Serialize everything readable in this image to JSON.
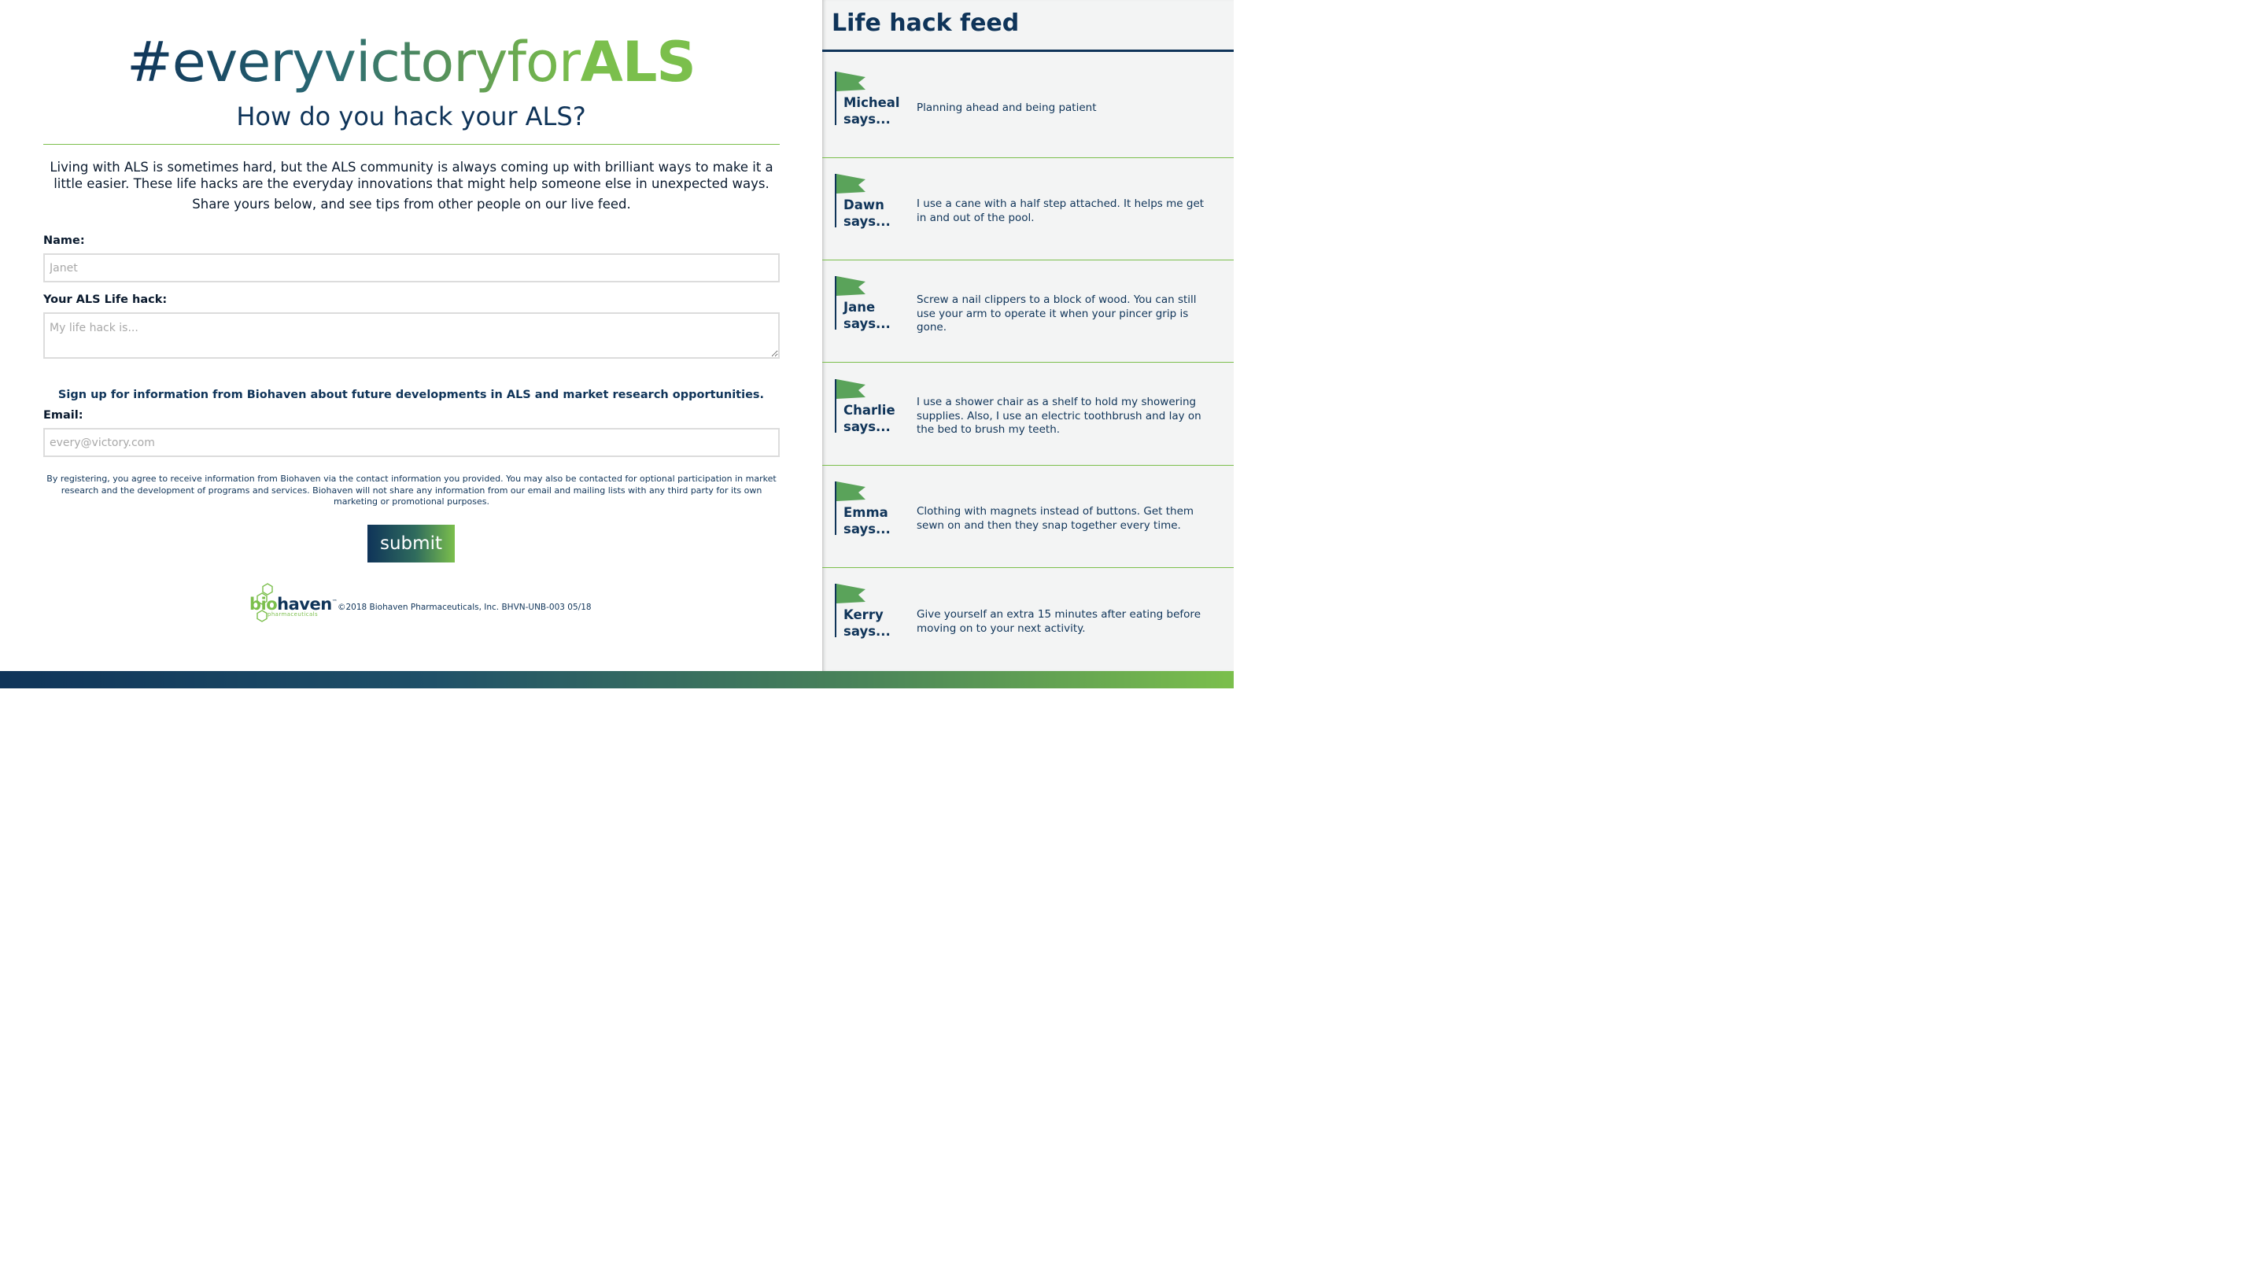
{
  "hero": {
    "title_hash_part": "#everyvictoryfor",
    "title_strong_part": "ALS",
    "subtitle": "How do you hack your ALS?"
  },
  "intro": {
    "paragraph": "Living with ALS is sometimes hard, but the ALS community is always coming up with brilliant ways to make it a little easier. These life hacks are the everyday innovations that might help someone else in unexpected ways.",
    "share_line": "Share yours below, and see tips from other people on our live feed."
  },
  "form": {
    "name_label": "Name:",
    "name_placeholder": "Janet",
    "hack_label": "Your ALS Life hack:",
    "hack_placeholder": "My life hack is...",
    "signup_text": "Sign up for information from Biohaven about future developments in ALS and market research opportunities.",
    "email_label": "Email:",
    "email_placeholder": "every@victory.com",
    "legal_text": "By registering, you agree to receive information from Biohaven via the contact information you provided. You may also be contacted for optional participation in market research and the development of programs and services. Biohaven will not share any information from our email and mailing lists with any third party for its own marketing or promotional purposes.",
    "submit_label": "submit"
  },
  "footer": {
    "brand_green": "bio",
    "brand_blue": "haven",
    "brand_tm": "™",
    "brand_sub": "pharmaceuticals",
    "copyright": "©2018 Biohaven Pharmaceuticals, Inc. BHVN-UNB-003  05/18"
  },
  "feed": {
    "title": "Life hack feed",
    "items": [
      {
        "name": "Micheal",
        "says": "says...",
        "message": "Planning ahead and being patient"
      },
      {
        "name": "Dawn",
        "says": "says...",
        "message": "I use a cane with a half step attached. It helps me get in and out of the pool."
      },
      {
        "name": "Jane",
        "says": "says...",
        "message": "Screw a nail clippers to a block of wood. You can still use your arm to operate it when your pincer grip is gone."
      },
      {
        "name": "Charlie",
        "says": "says...",
        "message": "I use a shower chair as a shelf to hold my showering supplies. Also, I use an electric toothbrush and lay on the bed to brush my teeth."
      },
      {
        "name": "Emma",
        "says": "says...",
        "message": "Clothing with magnets instead of buttons. Get them sewn on and then they snap together every time."
      },
      {
        "name": "Kerry",
        "says": "says...",
        "message": "Give yourself an extra 15 minutes after eating before moving on to your next activity."
      }
    ]
  },
  "colors": {
    "navy": "#0f3459",
    "green": "#7bbf4c",
    "feed_bg": "#f3f4f4"
  },
  "icons": {
    "feed_flag": "flag-icon",
    "brand_mark": "hexagon-molecule-icon"
  }
}
